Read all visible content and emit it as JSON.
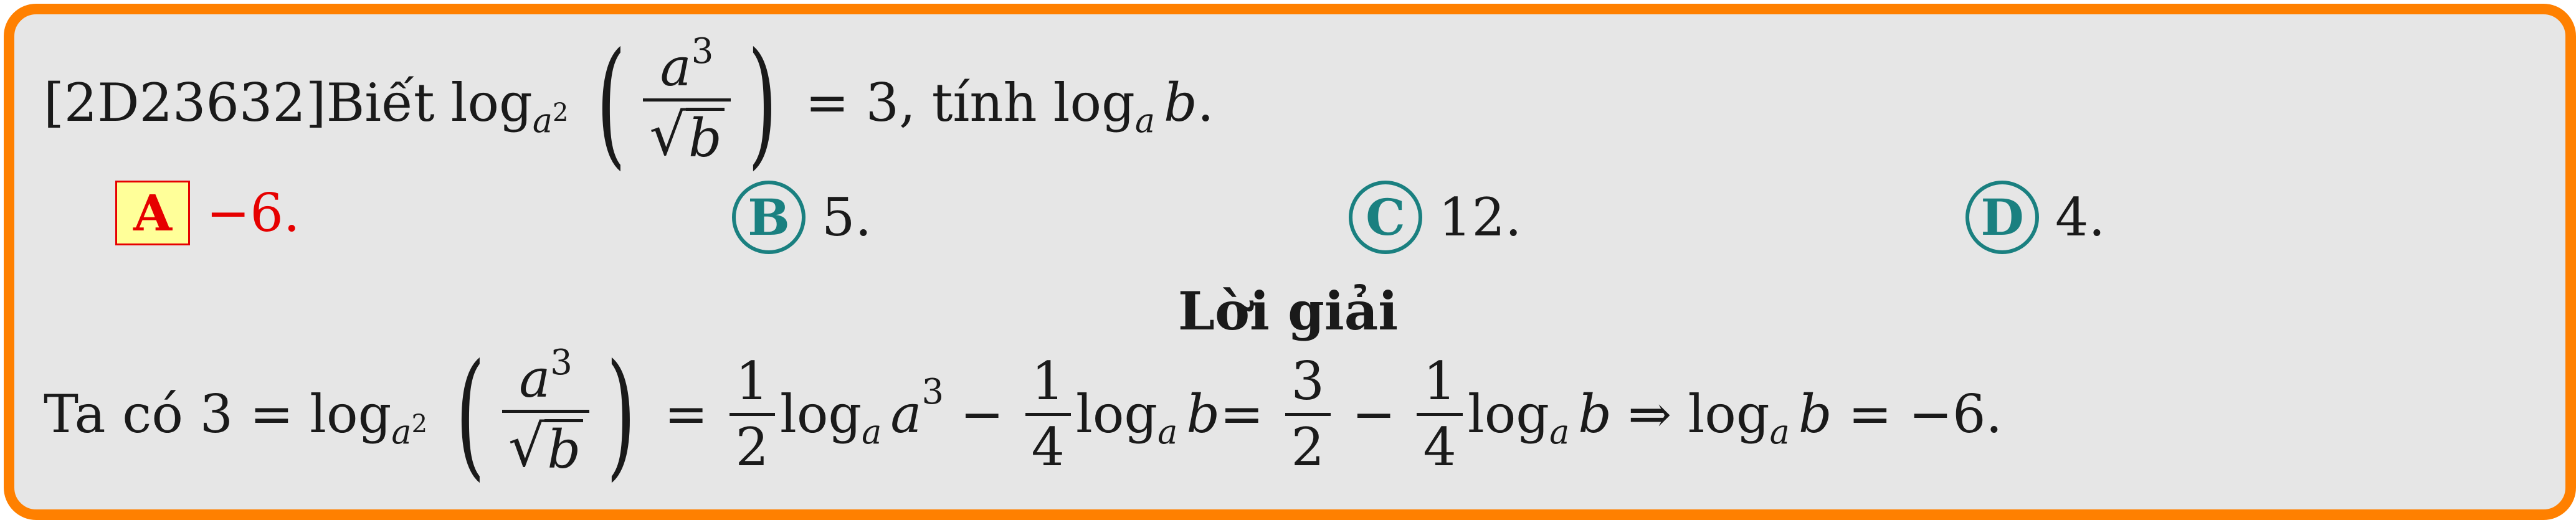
{
  "question": {
    "code": "[2D23632]",
    "prefix": "Biết",
    "log": "log",
    "base_a": "a",
    "base_pow": "2",
    "frac_num_var": "a",
    "frac_num_pow": "3",
    "frac_den_var": "b",
    "equals": "= 3,",
    "tinh": "tính",
    "ask_log": "log",
    "ask_base": "a",
    "ask_var": "b",
    "ask_end": "."
  },
  "options": [
    {
      "letter": "A",
      "text": "−6.",
      "correct": true
    },
    {
      "letter": "B",
      "text": "5.",
      "correct": false
    },
    {
      "letter": "C",
      "text": "12.",
      "correct": false
    },
    {
      "letter": "D",
      "text": "4.",
      "correct": false
    }
  ],
  "solution_heading": "Lời giải",
  "solution": {
    "start": "Ta có 3 =",
    "log": "log",
    "base_a": "a",
    "base_pow": "2",
    "frac_num_var": "a",
    "frac_num_pow": "3",
    "frac_den_var": "b",
    "eq1": "=",
    "half_num": "1",
    "half_den": "2",
    "t1_log": "log",
    "t1_base": "a",
    "t1_var": "a",
    "t1_pow": "3",
    "minus1": "−",
    "q_num": "1",
    "q_den": "4",
    "t2_log": "log",
    "t2_base": "a",
    "t2_var": "b",
    "eq2": "=",
    "tf_num": "3",
    "tf_den": "2",
    "minus2": "−",
    "q2_num": "1",
    "q2_den": "4",
    "t3_log": "log",
    "t3_base": "a",
    "t3_var": "b",
    "implies": "⇒",
    "t4_log": "log",
    "t4_base": "a",
    "t4_var": "b",
    "result": "= −6."
  },
  "colors": {
    "border": "#ff8000",
    "background": "#e6e6e6",
    "correct": "#e60000",
    "option_circle": "#1a8080",
    "highlight": "#ffff99"
  }
}
